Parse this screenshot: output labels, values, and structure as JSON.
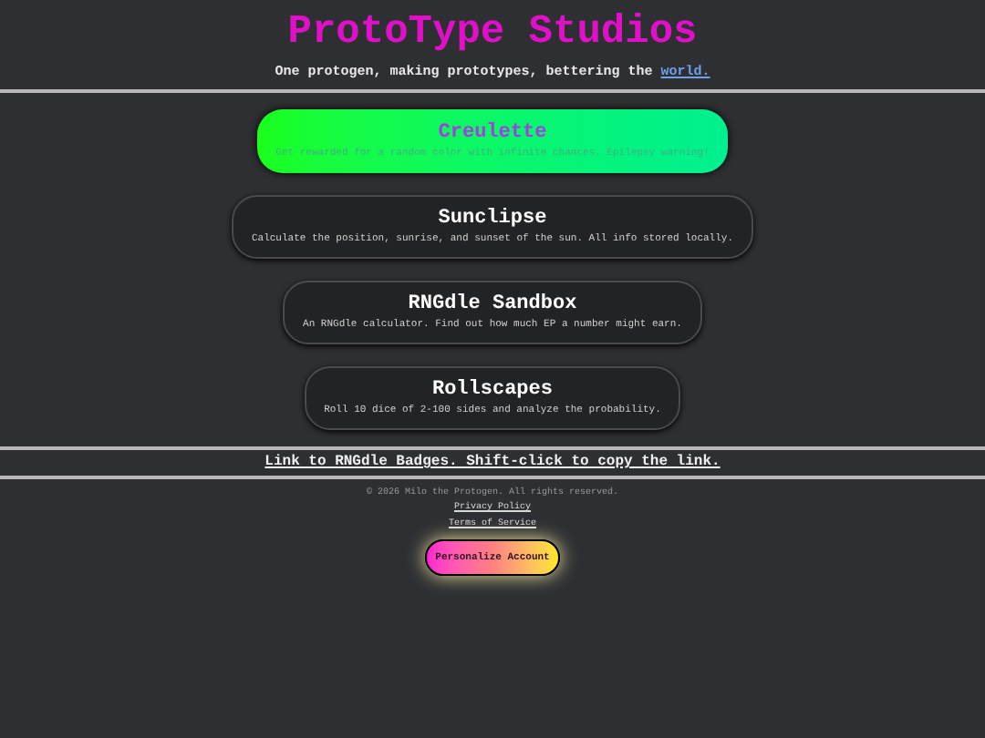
{
  "header": {
    "title": "ProtoType Studios",
    "tagline_before": "One protogen, making prototypes, bettering the ",
    "tagline_link": "world."
  },
  "projects": [
    {
      "title": "Creulette",
      "description": "Get rewarded for a random color with infinite chances. Epilepsy warning!",
      "highlighted": true
    },
    {
      "title": "Sunclipse",
      "description": "Calculate the position, sunrise, and sunset of the sun. All info stored locally.",
      "highlighted": false
    },
    {
      "title": "RNGdle Sandbox",
      "description": "An RNGdle calculator. Find out how much EP a number might earn.",
      "highlighted": false
    },
    {
      "title": "Rollscapes",
      "description": "Roll 10 dice of 2-100 sides and analyze the probability.",
      "highlighted": false
    }
  ],
  "badges_link": "Link to RNGdle Badges. Shift-click to copy the link.",
  "footer": {
    "copyright": "© 2026 Milo the Protogen. All rights reserved.",
    "links": [
      "Privacy Policy",
      "Terms of Service"
    ],
    "button": "Personalize Account"
  }
}
